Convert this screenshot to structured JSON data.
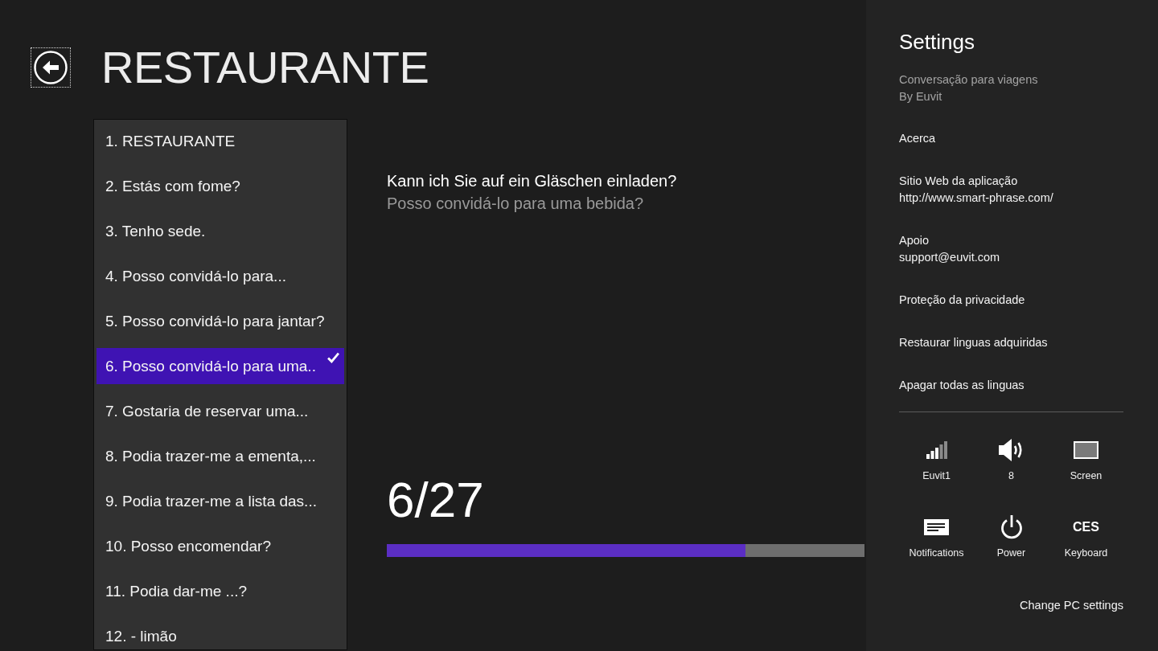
{
  "header": {
    "back_button": {
      "focused": true
    },
    "title": "RESTAURANTE"
  },
  "phrase_list": {
    "items": [
      {
        "label": "1. RESTAURANTE",
        "selected": false
      },
      {
        "label": "2. Estás com fome?",
        "selected": false
      },
      {
        "label": "3. Tenho sede.",
        "selected": false
      },
      {
        "label": "4. Posso convidá-lo para...",
        "selected": false
      },
      {
        "label": "5. Posso convidá-lo para jantar?",
        "selected": false
      },
      {
        "label": "6. Posso convidá-lo para uma..",
        "selected": true
      },
      {
        "label": "7. Gostaria de reservar uma...",
        "selected": false
      },
      {
        "label": "8. Podia trazer-me a ementa,...",
        "selected": false
      },
      {
        "label": "9. Podia trazer-me a lista das...",
        "selected": false
      },
      {
        "label": "10. Posso encomendar?",
        "selected": false
      },
      {
        "label": "11. Podia dar-me ...?",
        "selected": false
      },
      {
        "label": "12. - limão",
        "selected": false
      }
    ]
  },
  "phrase": {
    "foreign": "Kann ich Sie auf ein Gläschen einladen?",
    "translation": "Posso convidá-lo para uma bebida?"
  },
  "progress": {
    "counter": "6/27",
    "level": 0.75
  },
  "settings_pane": {
    "title": "Settings",
    "app_name": "Conversação para viagens",
    "publisher": "By Euvit",
    "commands": [
      {
        "label": "Acerca"
      },
      {
        "label": "Sitio Web da aplicação",
        "detail": "http://www.smart-phrase.com/"
      },
      {
        "label": "Apoio",
        "detail": "support@euvit.com"
      },
      {
        "label": "Proteção da privacidade"
      },
      {
        "label": "Restaurar linguas adquiridas"
      },
      {
        "label": "Apagar todas as linguas"
      }
    ],
    "quick_settings": [
      {
        "kind": "network",
        "label": "Euvit1"
      },
      {
        "kind": "volume",
        "label": "8"
      },
      {
        "kind": "screen",
        "label": "Screen"
      },
      {
        "kind": "notifications",
        "label": "Notifications"
      },
      {
        "kind": "power",
        "label": "Power"
      },
      {
        "kind": "keyboard",
        "glyph": "CES",
        "label": "Keyboard"
      }
    ],
    "footer_link": "Change PC settings"
  }
}
